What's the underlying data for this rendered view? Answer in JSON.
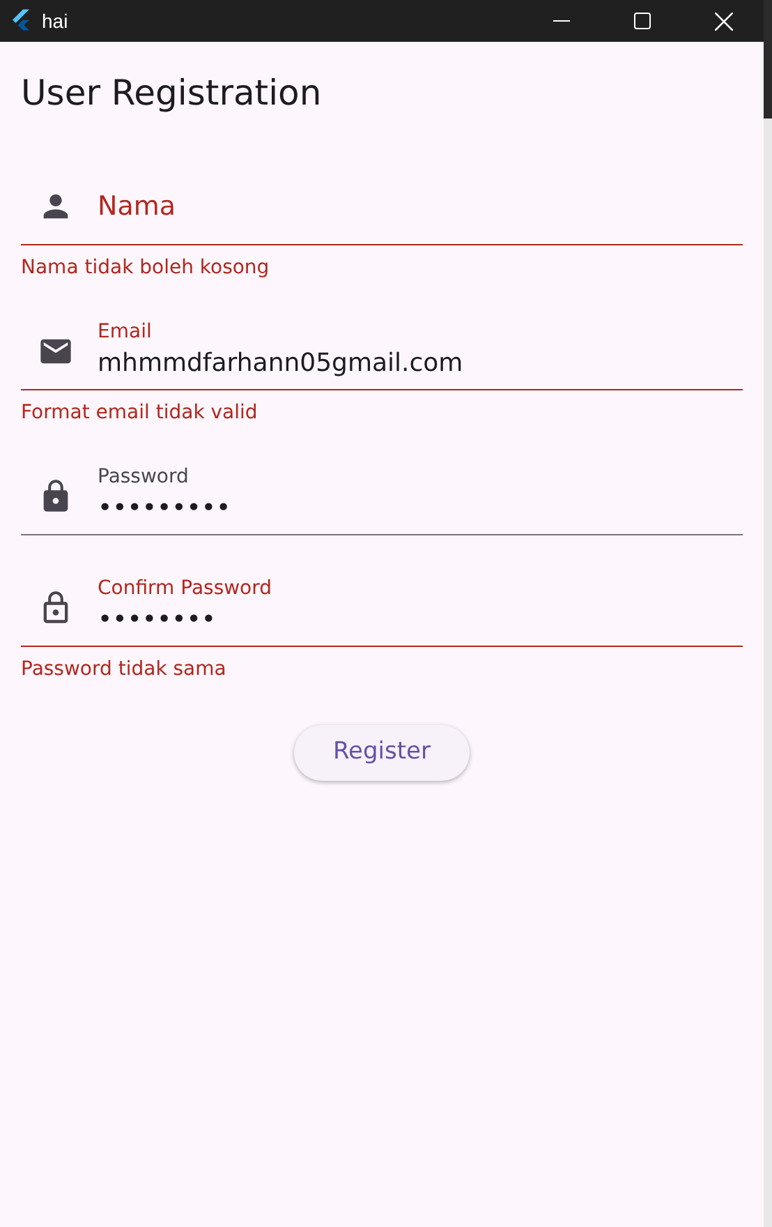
{
  "window": {
    "title": "hai"
  },
  "page": {
    "title": "User Registration"
  },
  "fields": [
    {
      "kind": "person",
      "label": "Nama",
      "error": "Nama tidak boleh kosong"
    },
    {
      "kind": "mail",
      "label": "Email",
      "value": "mhmmdfarhann05gmail.com",
      "error": "Format email tidak valid"
    },
    {
      "kind": "lock",
      "label": "Password",
      "value": "•••••••••"
    },
    {
      "kind": "lock-outline",
      "label": "Confirm Password",
      "value": "••••••••",
      "error": "Password tidak sama"
    }
  ],
  "button": {
    "label": "Register"
  }
}
